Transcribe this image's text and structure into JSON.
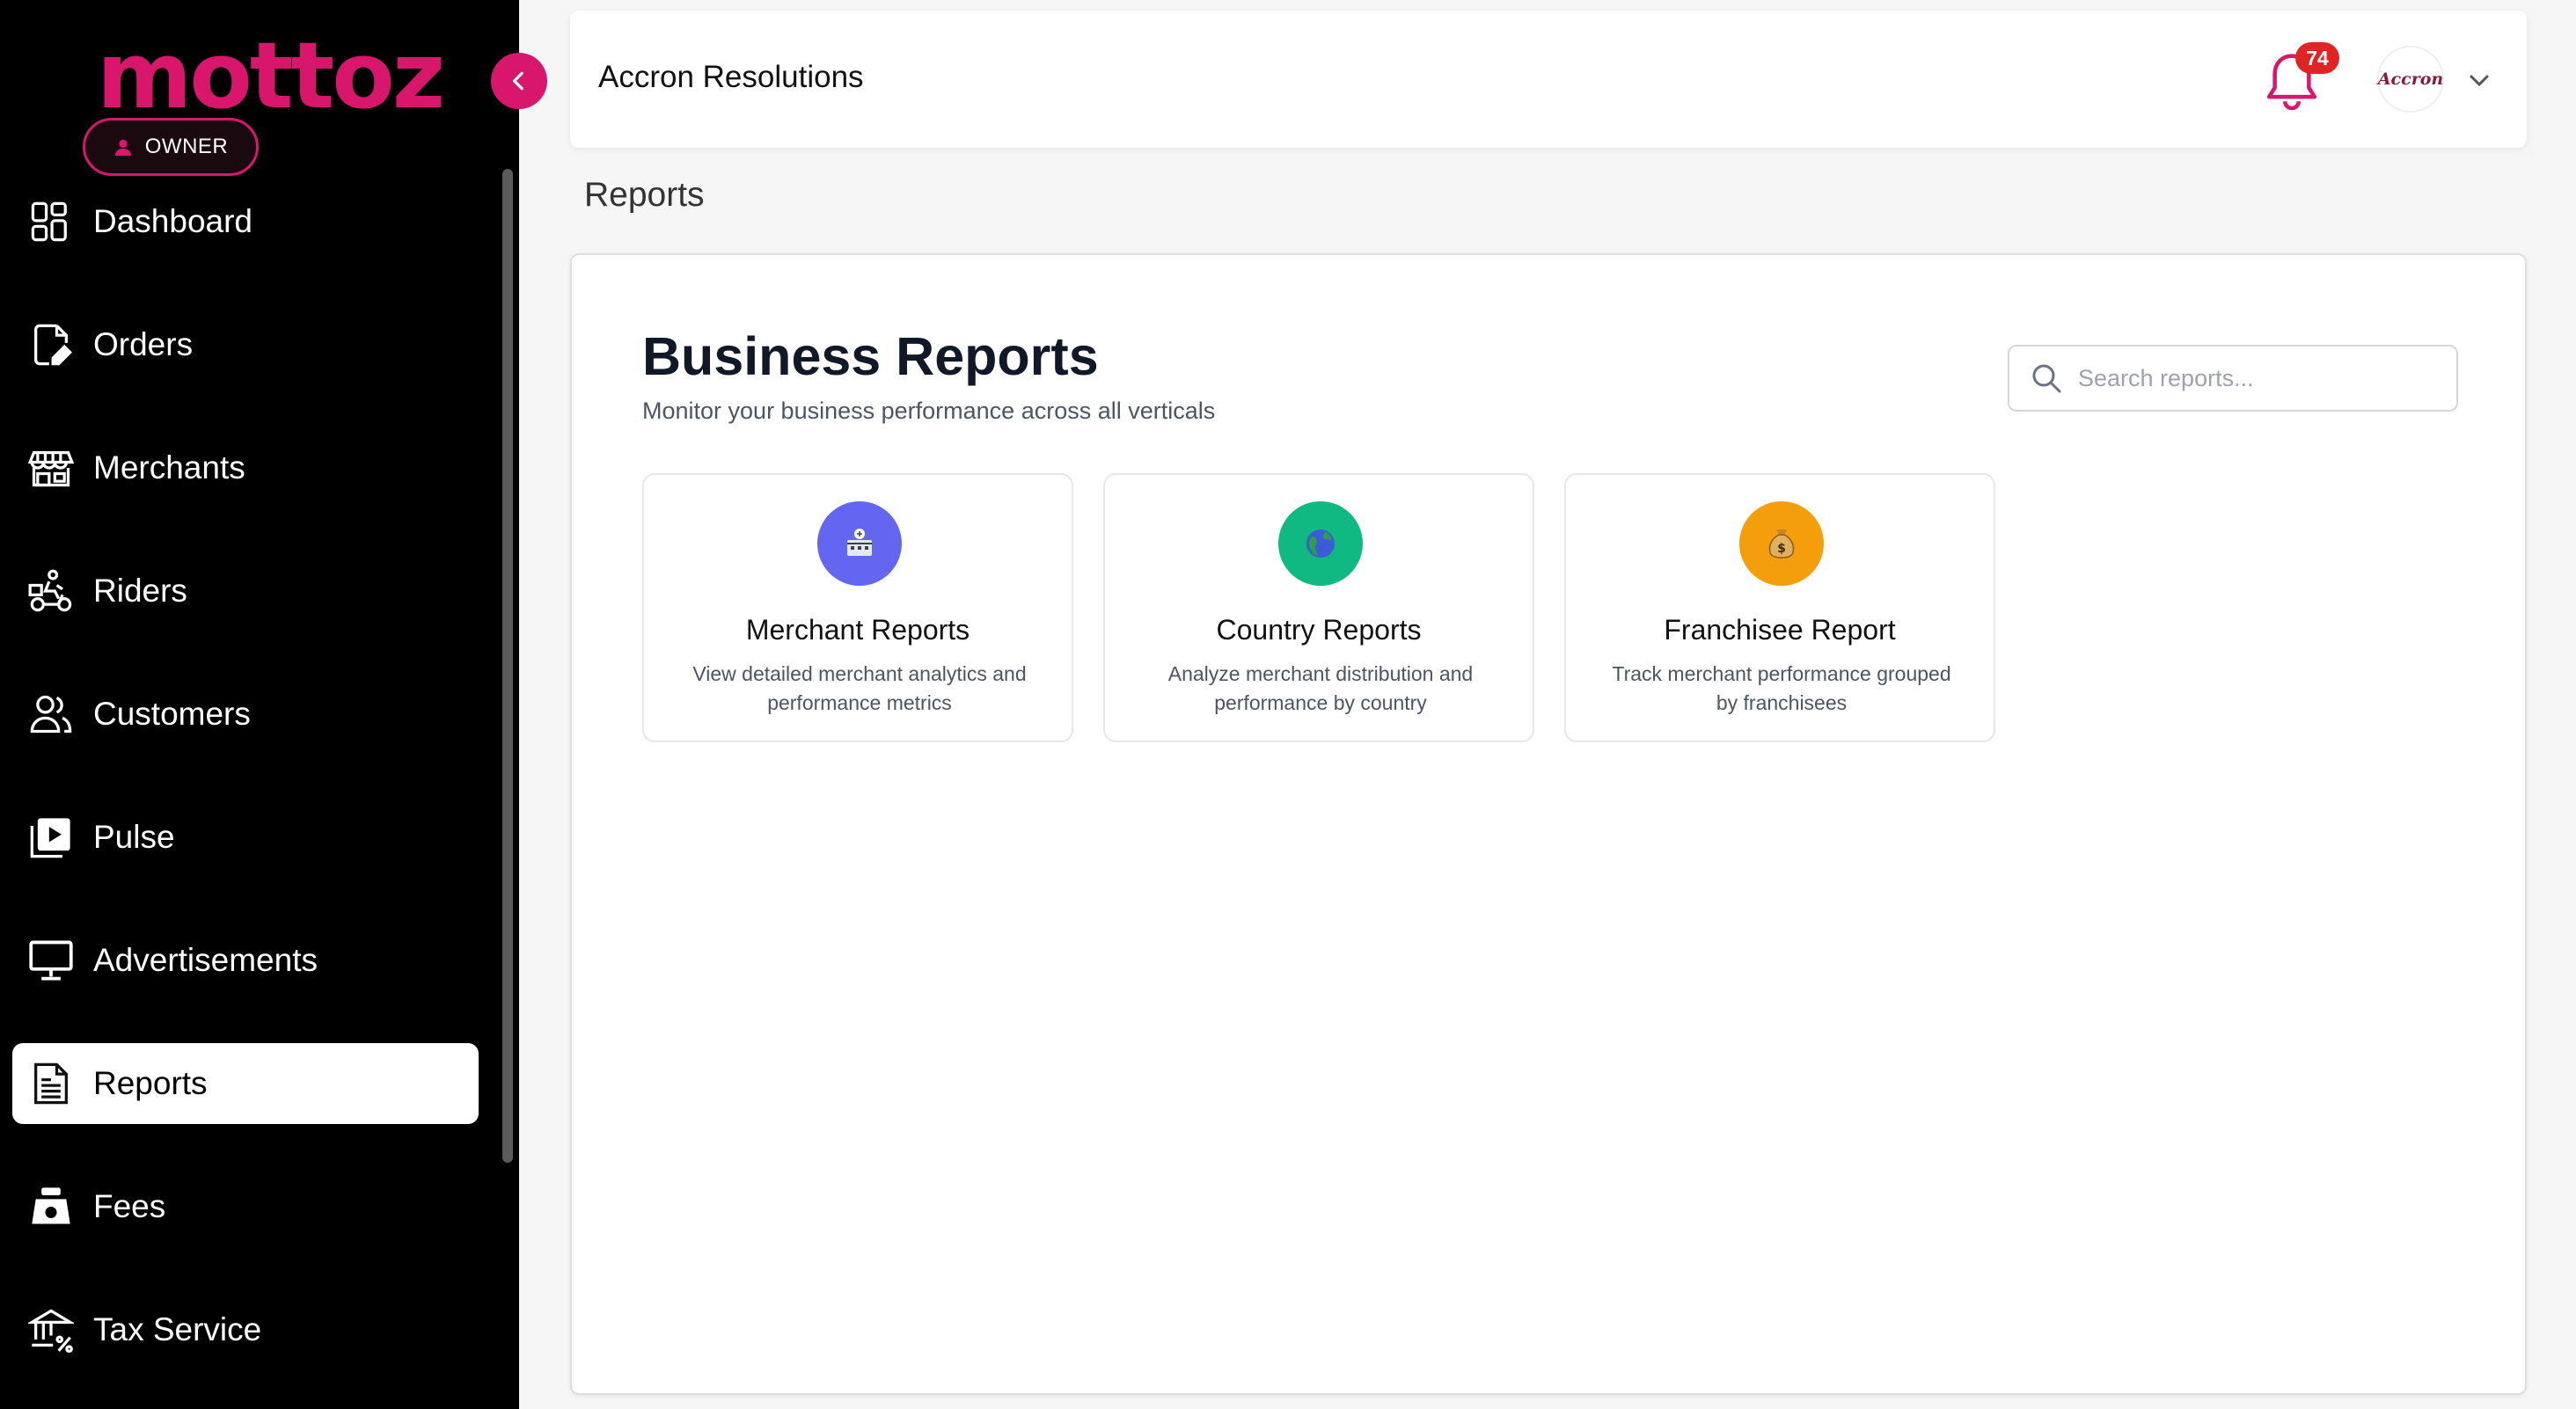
{
  "sidebar": {
    "logo": "mottoz",
    "role_badge": "OWNER",
    "items": [
      {
        "label": "Dashboard",
        "icon": "dashboard-icon"
      },
      {
        "label": "Orders",
        "icon": "orders-icon"
      },
      {
        "label": "Merchants",
        "icon": "merchants-icon"
      },
      {
        "label": "Riders",
        "icon": "riders-icon"
      },
      {
        "label": "Customers",
        "icon": "customers-icon"
      },
      {
        "label": "Pulse",
        "icon": "pulse-icon"
      },
      {
        "label": "Advertisements",
        "icon": "advertisements-icon"
      },
      {
        "label": "Reports",
        "icon": "reports-icon",
        "active": true
      },
      {
        "label": "Fees",
        "icon": "fees-icon"
      },
      {
        "label": "Tax Service",
        "icon": "tax-service-icon"
      }
    ]
  },
  "header": {
    "company_name": "Accron Resolutions",
    "notification_count": "74",
    "avatar_text": "Accron"
  },
  "page": {
    "title": "Reports"
  },
  "main": {
    "heading": "Business Reports",
    "subheading": "Monitor your business performance across all verticals",
    "search": {
      "placeholder": "Search reports...",
      "value": ""
    },
    "cards": [
      {
        "title": "Merchant Reports",
        "description": "View detailed merchant analytics and performance metrics",
        "icon": "merchant-report-icon",
        "color": "#6366f1"
      },
      {
        "title": "Country Reports",
        "description": "Analyze merchant distribution and performance by country",
        "icon": "globe-icon",
        "color": "#10b981"
      },
      {
        "title": "Franchisee Report",
        "description": "Track merchant performance grouped by franchisees",
        "icon": "money-bag-icon",
        "color": "#f59e0b"
      }
    ]
  },
  "colors": {
    "brand": "#d8176c",
    "sidebar_bg": "#000000",
    "badge_red": "#e02424"
  }
}
